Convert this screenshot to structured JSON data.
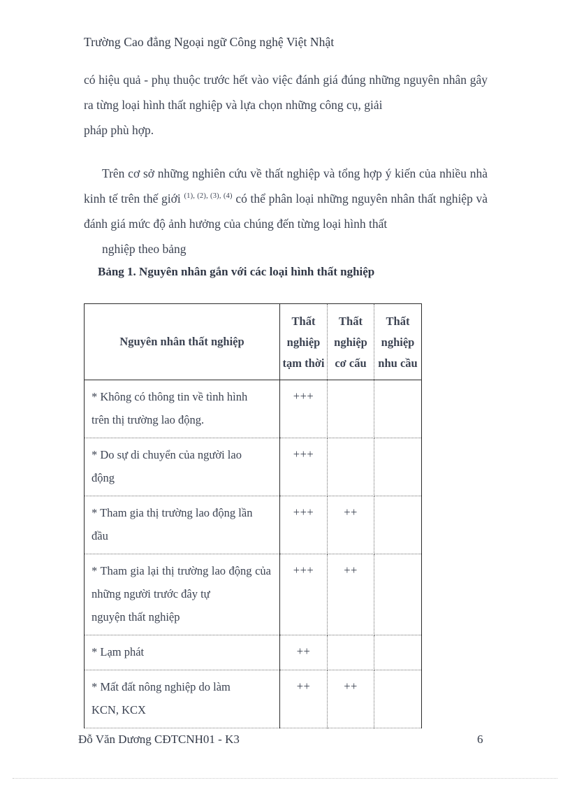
{
  "page": {
    "running_head": "Trường Cao đẳng Ngoại ngữ Công nghệ Việt Nhật",
    "footer_author": "Đỗ Văn Dương  CĐTCNH01 - K3",
    "page_number": "6",
    "text_color": "#3c4352",
    "rule_color": "#2b2b2b"
  },
  "body": {
    "paragraph1": {
      "line1": "có hiệu quả - phụ thuộc trước hết vào việc đánh giá đúng những nguyên",
      "line2": "nhân gây ra từng loại hình thất nghiệp và lựa chọn những công cụ, giải",
      "line3": "pháp phù hợp."
    },
    "paragraph2": {
      "line1": "Trên cơ sở những nghiên cứu về thất nghiệp và tổng hợp ý kiến của nhiều",
      "line2_before_refs": "nhà kinh tế trên thế giới ",
      "refs": "(1), (2), (3), (4)",
      "line2_after_refs": " có thể phân loại những nguyên nhân thất",
      "line3": "nghiệp và đánh giá mức độ ảnh hưởng của chúng đến từng loại hình thất",
      "line4": "nghiệp theo bảng"
    }
  },
  "table": {
    "caption": "Bảng 1. Nguyên nhân gắn với các loại hình thất nghiệp",
    "headers": {
      "cause": "Nguyên nhân thất nghiệp",
      "col1": {
        "l1": "Thất",
        "l2": "nghiệp",
        "l3": "tạm thời"
      },
      "col2": {
        "l1": "Thất",
        "l2": "nghiệp",
        "l3": "cơ cấu"
      },
      "col3": {
        "l1": "Thất",
        "l2": "nghiệp",
        "l3": "nhu cầu"
      }
    },
    "rows": [
      {
        "cause_l1": "* Không có thông tin về tình hình",
        "cause_l2": "trên thị trường lao động.",
        "cause_l3": "",
        "tam_thoi": "+++",
        "co_cau": "",
        "nhu_cau": ""
      },
      {
        "cause_l1": "* Do sự di chuyển của người lao",
        "cause_l2": "động",
        "cause_l3": "",
        "tam_thoi": "+++",
        "co_cau": "",
        "nhu_cau": ""
      },
      {
        "cause_l1": "* Tham gia thị trường lao động lần",
        "cause_l2": "đầu",
        "cause_l3": "",
        "tam_thoi": "+++",
        "co_cau": "++",
        "nhu_cau": ""
      },
      {
        "cause_l1": "* Tham gia lại thị trường lao động",
        "cause_l2": "của những người trước đây tự",
        "cause_l3": "nguyện thất nghiệp",
        "tam_thoi": "+++",
        "co_cau": "++",
        "nhu_cau": ""
      },
      {
        "cause_l1": "* Lạm phát",
        "cause_l2": "",
        "cause_l3": "",
        "tam_thoi": "++",
        "co_cau": "",
        "nhu_cau": ""
      },
      {
        "cause_l1": "* Mất đất nông nghiệp do làm",
        "cause_l2": "KCN, KCX",
        "cause_l3": "",
        "tam_thoi": "++",
        "co_cau": "++",
        "nhu_cau": ""
      }
    ]
  }
}
